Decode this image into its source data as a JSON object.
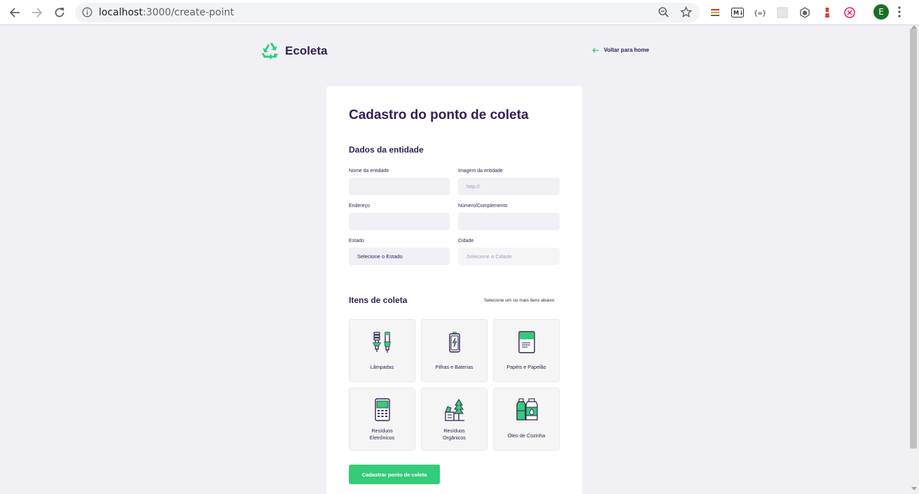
{
  "browser": {
    "url_host": "localhost",
    "url_path": ":3000/create-point",
    "avatar_letter": "E"
  },
  "header": {
    "logo_text": "Ecoleta",
    "back_link": "Voltar para home"
  },
  "form": {
    "title": "Cadastro do ponto de coleta",
    "entity_section": "Dados da entidade",
    "fields": {
      "name_label": "Nome da entidade",
      "image_label": "Imagem da entidade",
      "image_placeholder": "http://",
      "address_label": "Endereço",
      "number_label": "Número/Complemento",
      "state_label": "Estado",
      "state_value": "Selecione o Estado",
      "city_label": "Cidade",
      "city_value": "Selecione a Cidade"
    },
    "items_section": "Itens de coleta",
    "items_hint": "Selecione um ou mais itens abaixo",
    "items": [
      {
        "label": "Lâmpadas",
        "icon": "lamp-icon"
      },
      {
        "label": "Pilhas e Baterias",
        "icon": "battery-icon"
      },
      {
        "label": "Papéis e Papelão",
        "icon": "paper-icon"
      },
      {
        "label": "Resíduos\nEletrônicos",
        "icon": "electronics-icon"
      },
      {
        "label": "Resíduos\nOrgânicos",
        "icon": "organic-icon"
      },
      {
        "label": "Óleo de Cozinha",
        "icon": "oil-icon"
      }
    ],
    "submit_label": "Cadastrar ponto de coleta"
  },
  "colors": {
    "primary": "#322153",
    "accent": "#34cb79",
    "background": "#f0f0f5"
  }
}
